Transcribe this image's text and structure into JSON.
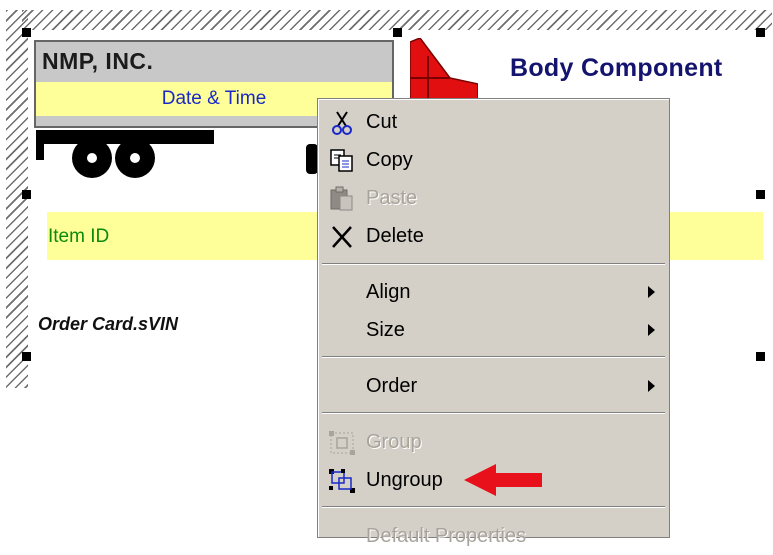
{
  "report": {
    "company": "NMP, INC.",
    "date_time": "Date & Time",
    "title": "Body Component",
    "item_id": "Item ID",
    "order_field": "Order Card.sVIN"
  },
  "context_menu": {
    "items": [
      {
        "label": "Cut",
        "icon": "scissors-icon",
        "enabled": true
      },
      {
        "label": "Copy",
        "icon": "copy-icon",
        "enabled": true
      },
      {
        "label": "Paste",
        "icon": "paste-icon",
        "enabled": false
      },
      {
        "label": "Delete",
        "icon": "delete-x-icon",
        "enabled": true
      },
      {
        "label": "Align",
        "submenu": true
      },
      {
        "label": "Size",
        "submenu": true
      },
      {
        "label": "Order",
        "submenu": true
      },
      {
        "label": "Group",
        "icon": "group-icon",
        "enabled": false
      },
      {
        "label": "Ungroup",
        "icon": "ungroup-icon",
        "enabled": true
      },
      {
        "label": "Default Properties",
        "enabled": false
      }
    ]
  },
  "colors": {
    "menu_bg": "#d4d0c8",
    "highlight_band": "#ffff99",
    "title_color": "#14146e",
    "item_id_color": "#0c8a0c",
    "arrow_color": "#e8101a"
  }
}
